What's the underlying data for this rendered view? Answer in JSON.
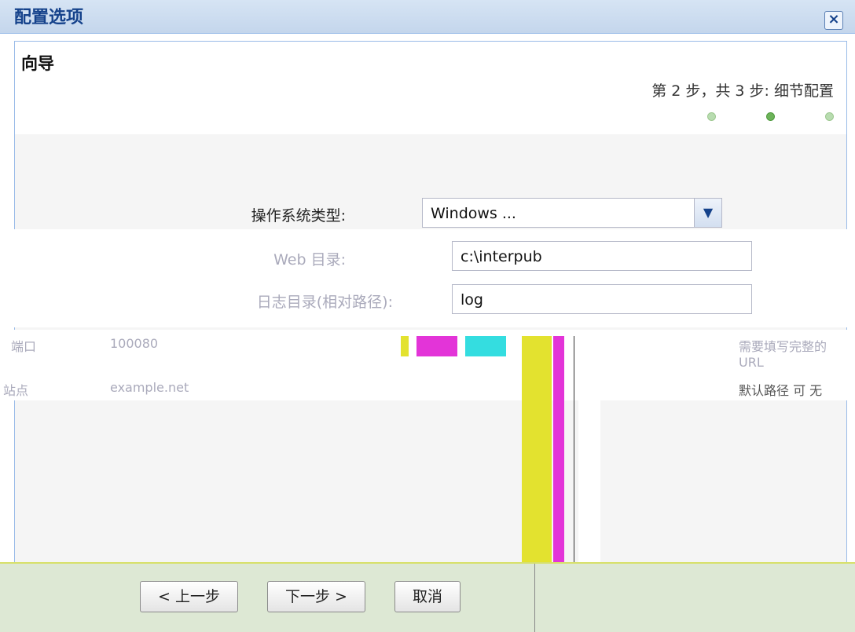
{
  "dialog": {
    "title": "配置选项",
    "close_icon": "×"
  },
  "wizard": {
    "title": "向导",
    "step_text": "第 2 步，共 3 步: 细节配置",
    "total_steps": 3,
    "current_step": 2
  },
  "form": {
    "os_type": {
      "label": "操作系统类型:",
      "value": "Windows ..."
    },
    "web_dir": {
      "label": "Web 目录:",
      "value": "c:\\interpub"
    },
    "log_dir": {
      "label": "日志目录(相对路径):",
      "value": "log"
    }
  },
  "overlay": {
    "left_label": "端口",
    "left_value": "100080",
    "left_label2": "站点",
    "left_value2": "example.net",
    "right_text1": "需要填写完整的 URL",
    "right_text2": "默认路径 可 无"
  },
  "buttons": {
    "prev": "< 上一步",
    "next": "下一步 >",
    "cancel": "取消"
  }
}
